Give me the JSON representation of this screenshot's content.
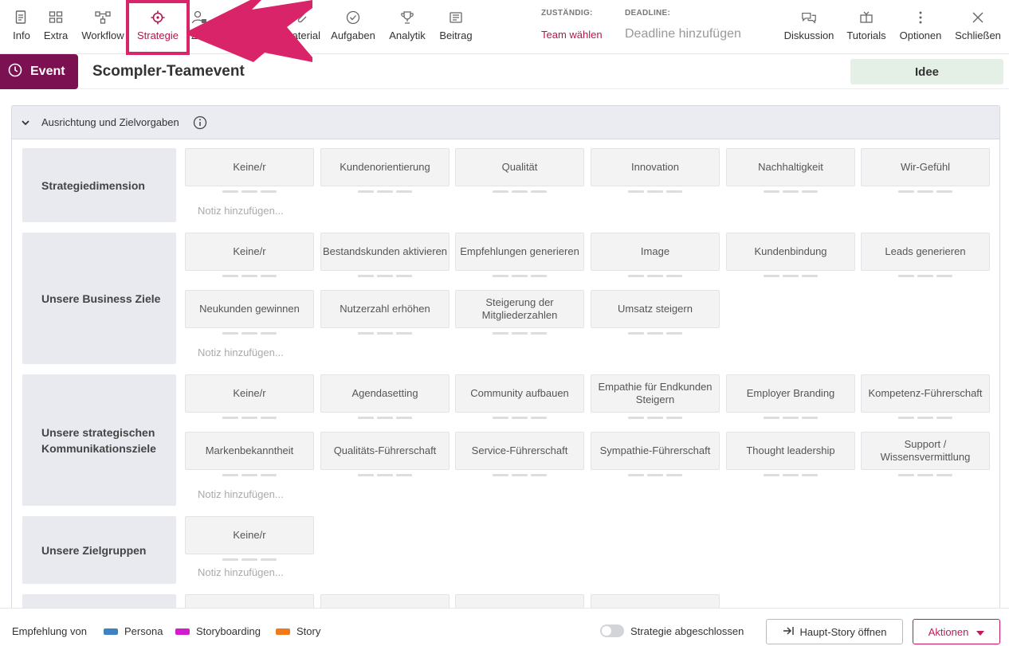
{
  "toolbar": {
    "items": [
      {
        "label": "Info",
        "icon": "document-icon"
      },
      {
        "label": "Extra",
        "icon": "grid-icon"
      },
      {
        "label": "Workflow",
        "icon": "workflow-icon"
      },
      {
        "label": "Strategie",
        "icon": "crosshair-icon",
        "active": true
      },
      {
        "label": "Zugri",
        "icon": "user-lock-icon"
      },
      {
        "label": "aterial",
        "icon": "paperclip-icon"
      },
      {
        "label": "Aufgaben",
        "icon": "check-circle-icon"
      },
      {
        "label": "Analytik",
        "icon": "trophy-icon"
      },
      {
        "label": "Beitrag",
        "icon": "newspaper-icon"
      }
    ],
    "assignee_caption": "ZUSTÄNDIG:",
    "assignee_value": "Team wählen",
    "deadline_caption": "DEADLINE:",
    "deadline_value": "Deadline hinzufügen",
    "right_items": [
      {
        "label": "Diskussion",
        "icon": "chat-icon"
      },
      {
        "label": "Tutorials",
        "icon": "tutorial-icon"
      },
      {
        "label": "Optionen",
        "icon": "kebab-icon"
      },
      {
        "label": "Schließen",
        "icon": "close-icon"
      }
    ]
  },
  "header": {
    "badge": "Event",
    "title": "Scompler-Teamevent",
    "status": "Idee"
  },
  "panel": {
    "title": "Ausrichtung und Zielvorgaben",
    "note_placeholder": "Notiz hinzufügen...",
    "rows": [
      {
        "label": "Strategiedimension",
        "options": [
          "Keine/r",
          "Kundenorientierung",
          "Qualität",
          "Innovation",
          "Nachhaltigkeit",
          "Wir-Gefühl"
        ]
      },
      {
        "label": "Unsere Business Ziele",
        "options": [
          "Keine/r",
          "Bestandskunden aktivieren",
          "Empfehlungen generieren",
          "Image",
          "Kundenbindung",
          "Leads generieren",
          "Neukunden gewinnen",
          "Nutzerzahl erhöhen",
          "Steigerung der Mitgliederzahlen",
          "Umsatz steigern"
        ]
      },
      {
        "label": "Unsere strategischen Kommunikationsziele",
        "options": [
          "Keine/r",
          "Agendasetting",
          "Community aufbauen",
          "Empathie für Endkunden Steigern",
          "Employer Branding",
          "Kompetenz-Führerschaft",
          "Markenbekanntheit",
          "Qualitäts-Führerschaft",
          "Service-Führerschaft",
          "Sympathie-Führerschaft",
          "Thought leadership",
          "Support / Wissensvermittlung"
        ]
      },
      {
        "label": "Unsere Zielgruppen",
        "options": [
          "Keine/r"
        ]
      }
    ]
  },
  "footer": {
    "legend_label": "Empfehlung von",
    "legend": [
      {
        "label": "Persona",
        "color": "#3f82c4"
      },
      {
        "label": "Storyboarding",
        "color": "#d01bd0"
      },
      {
        "label": "Story",
        "color": "#f07a1a"
      }
    ],
    "toggle_label": "Strategie abgeschlossen",
    "open_button": "Haupt-Story öffnen",
    "actions_button": "Aktionen"
  }
}
